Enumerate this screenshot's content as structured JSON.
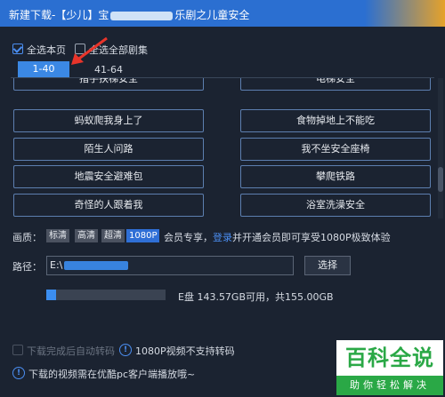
{
  "window": {
    "title_prefix": "新建下载-【少儿】宝",
    "title_suffix": "乐剧之儿童安全"
  },
  "select": {
    "current_page_label": "全选本页",
    "all_episodes_label": "全选全部剧集"
  },
  "tabs": [
    {
      "label": "1-40",
      "active": true
    },
    {
      "label": "41-64",
      "active": false
    }
  ],
  "episodes": [
    "指手扶梯安全",
    "电梯安全",
    "蚂蚁爬我身上了",
    "食物掉地上不能吃",
    "陌生人问路",
    "我不坐安全座椅",
    "地震安全避难包",
    "攀爬铁路",
    "奇怪的人跟着我",
    "浴室洗澡安全"
  ],
  "quality": {
    "label": "画质：",
    "options": [
      "标清",
      "高清",
      "超清",
      "1080P"
    ],
    "selected": "1080P",
    "note_before": "会员专享，",
    "login_link": "登录",
    "note_after": "并开通会员即可享受1080P极致体验"
  },
  "path": {
    "label": "路径：",
    "value_prefix": "E:\\",
    "choose_button": "选择"
  },
  "disk": {
    "info": "E盘 143.57GB可用，共155.00GB",
    "used_fraction": 0.08
  },
  "bottom": {
    "transcode_label": "下载完成后自动转码",
    "transcode_note": "1080P视频不支持转码",
    "storage_note": "下载的视频需在优酷pc客户端播放哦~"
  },
  "watermark": {
    "main": "百科全说",
    "sub": "助你轻松解决"
  },
  "colors": {
    "accent": "#3b88e4",
    "background": "#1b2331",
    "title_bar": "#2b6fd1",
    "arrow": "#e8342a"
  }
}
